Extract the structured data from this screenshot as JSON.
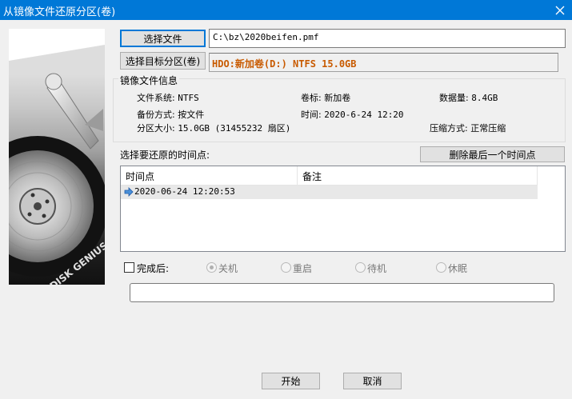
{
  "window": {
    "title": "从镜像文件还原分区(卷)"
  },
  "file": {
    "button_label": "选择文件",
    "path": "C:\\bz\\2020beifen.pmf"
  },
  "target": {
    "button_label": "选择目标分区(卷)",
    "partition_info": "HDO:新加卷(D:) NTFS 15.0GB"
  },
  "image_info": {
    "title": "镜像文件信息",
    "filesystem_label": "文件系统:",
    "filesystem_value": "NTFS",
    "volume_label": "卷标:",
    "volume_value": "新加卷",
    "data_size_label": "数据量:",
    "data_size_value": "8.4GB",
    "backup_mode_label": "备份方式:",
    "backup_mode_value": "按文件",
    "time_label": "时间:",
    "time_value": "2020-6-24 12:20",
    "partition_size_label": "分区大小:",
    "partition_size_value": "15.0GB  (31455232 扇区)",
    "compression_label": "压缩方式:",
    "compression_value": "正常压缩"
  },
  "restore_points": {
    "label": "选择要还原的时间点:",
    "delete_button_label": "删除最后一个时间点",
    "columns": [
      "时间点",
      "备注"
    ],
    "rows": [
      {
        "time": "2020-06-24 12:20:53",
        "note": ""
      }
    ]
  },
  "after_completion": {
    "label": "完成后:",
    "options": [
      {
        "label": "关机",
        "selected": true
      },
      {
        "label": "重启",
        "selected": false
      },
      {
        "label": "待机",
        "selected": false
      },
      {
        "label": "休眠",
        "selected": false
      }
    ]
  },
  "progress": {
    "value": 0
  },
  "footer": {
    "start_label": "开始",
    "cancel_label": "取消"
  },
  "image_art": {
    "brand_text": "DISK GENIUS"
  },
  "colors": {
    "titlebar": "#0078d7",
    "partition_text": "#c85a00",
    "accent": "#0078d7"
  }
}
